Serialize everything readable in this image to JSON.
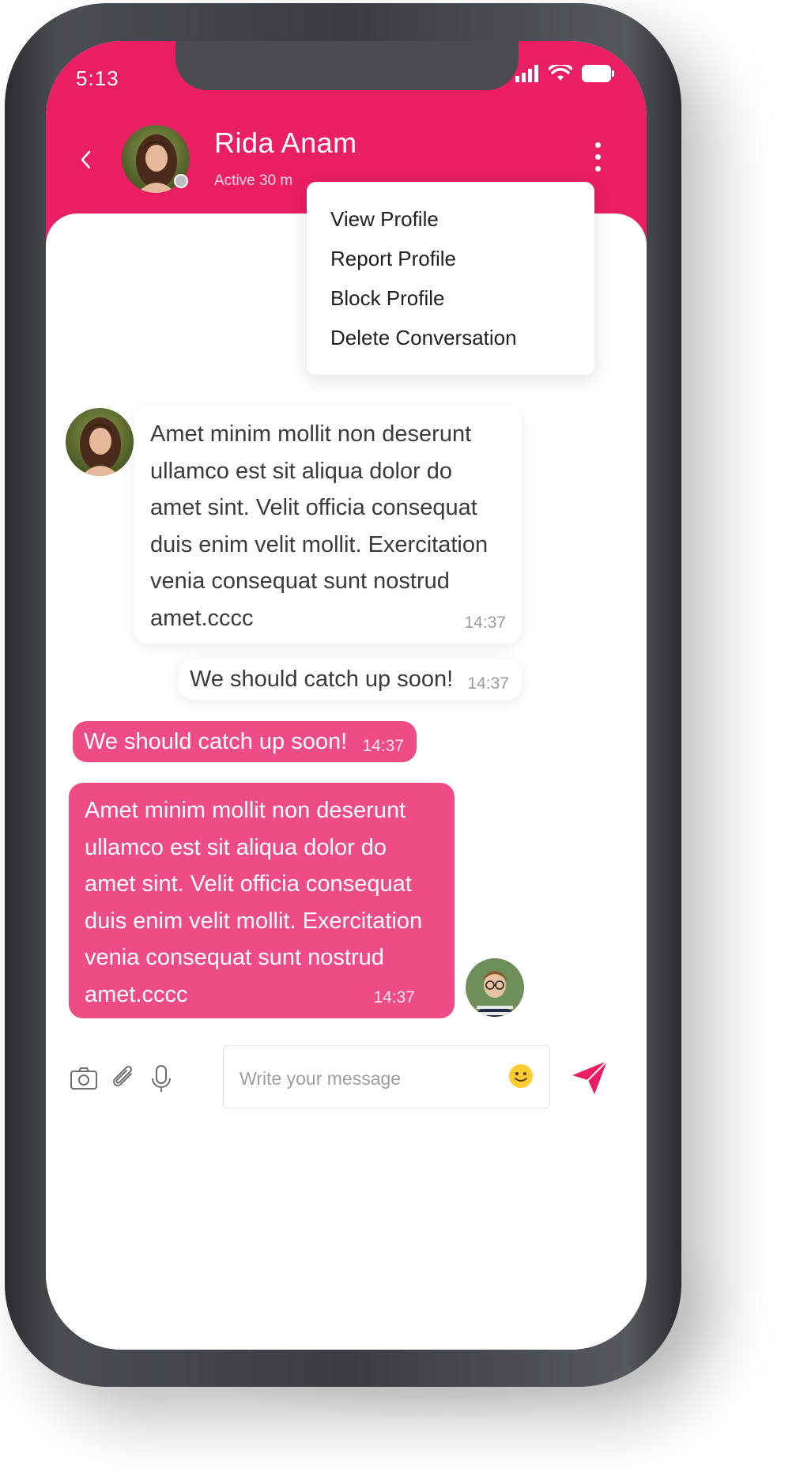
{
  "status_bar": {
    "time": "5:13"
  },
  "header": {
    "name": "Rida Anam",
    "active_text": "Active 30 m",
    "accent_color": "#e91e63"
  },
  "menu": {
    "items": [
      {
        "label": "View Profile"
      },
      {
        "label": "Report Profile"
      },
      {
        "label": "Block Profile"
      },
      {
        "label": "Delete Conversation"
      }
    ]
  },
  "messages": [
    {
      "direction": "incoming",
      "text": "Amet minim mollit non deserunt ullamco est sit aliqua dolor do amet sint. Velit officia consequat duis enim velit mollit. Exercitation venia consequat sunt nostrud amet.cccc",
      "time": "14:37"
    },
    {
      "direction": "incoming",
      "text": "We should catch up soon!",
      "time": "14:37"
    },
    {
      "direction": "outgoing",
      "text": "We should catch up soon!",
      "time": "14:37"
    },
    {
      "direction": "outgoing",
      "text": "Amet minim mollit non deserunt ullamco est sit aliqua dolor do amet sint. Velit officia consequat duis enim velit mollit. Exercitation venia consequat sunt nostrud amet.cccc",
      "time": "14:37"
    }
  ],
  "composer": {
    "placeholder": "Write your message",
    "icons": [
      "camera-icon",
      "paperclip-icon",
      "microphone-icon",
      "emoji-icon",
      "send-icon"
    ]
  }
}
